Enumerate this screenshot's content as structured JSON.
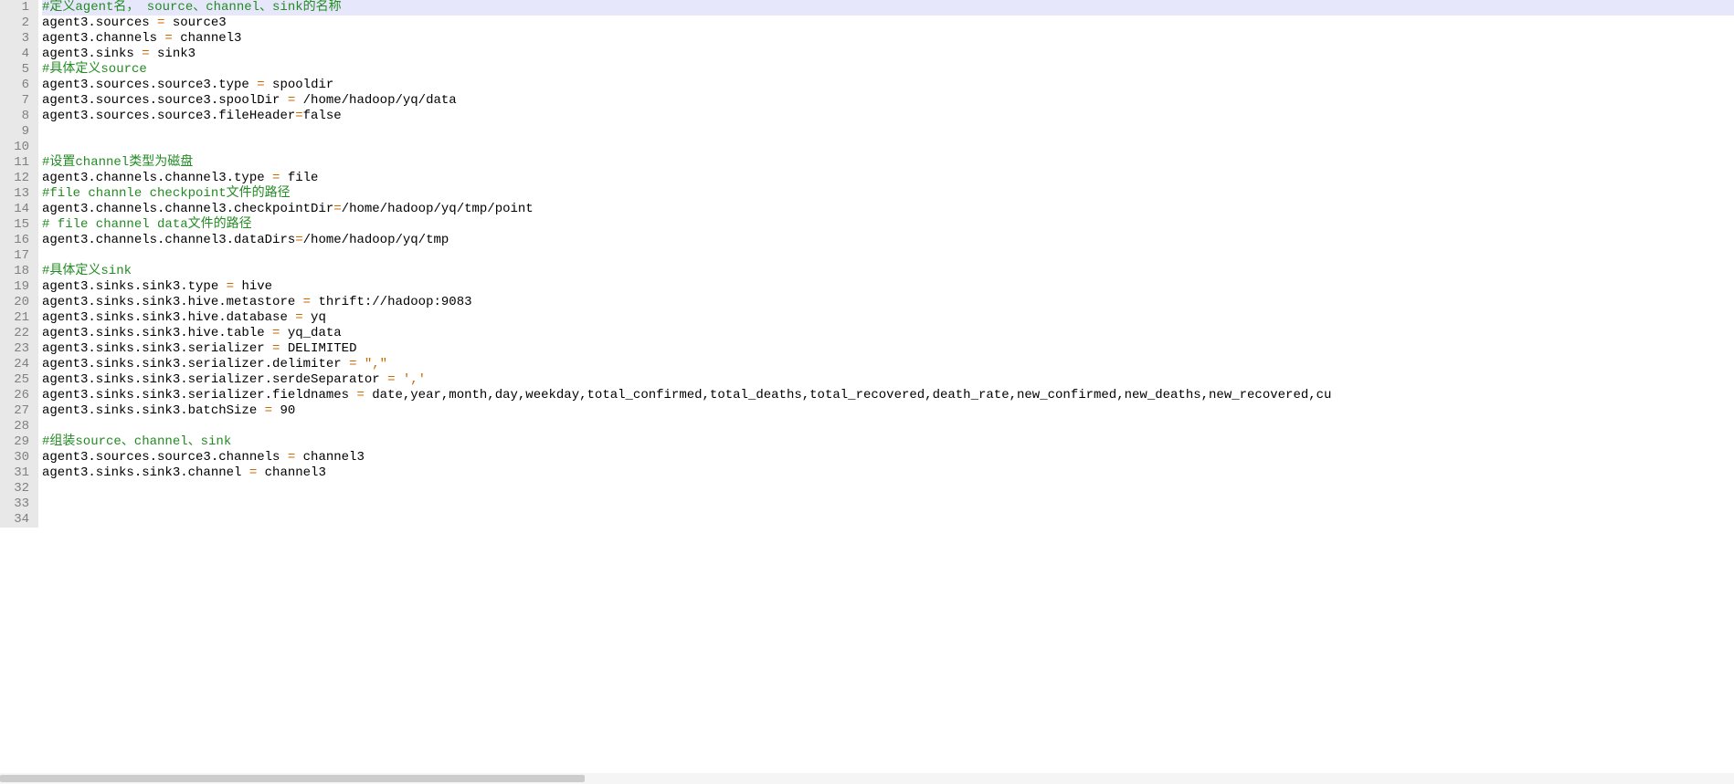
{
  "lines": [
    {
      "n": "1",
      "spans": [
        {
          "cls": "comment",
          "t": "#定义agent名， source、channel、sink的名称"
        }
      ]
    },
    {
      "n": "2",
      "spans": [
        {
          "t": "agent3.sources "
        },
        {
          "cls": "op",
          "t": "="
        },
        {
          "t": " source3"
        }
      ]
    },
    {
      "n": "3",
      "spans": [
        {
          "t": "agent3.channels "
        },
        {
          "cls": "op",
          "t": "="
        },
        {
          "t": " channel3"
        }
      ]
    },
    {
      "n": "4",
      "spans": [
        {
          "t": "agent3.sinks "
        },
        {
          "cls": "op",
          "t": "="
        },
        {
          "t": " sink3"
        }
      ]
    },
    {
      "n": "5",
      "spans": [
        {
          "cls": "comment",
          "t": "#具体定义source"
        }
      ]
    },
    {
      "n": "6",
      "spans": [
        {
          "t": "agent3.sources.source3.type "
        },
        {
          "cls": "op",
          "t": "="
        },
        {
          "t": " spooldir"
        }
      ]
    },
    {
      "n": "7",
      "spans": [
        {
          "t": "agent3.sources.source3.spoolDir "
        },
        {
          "cls": "op",
          "t": "="
        },
        {
          "t": " /home/hadoop/yq/data"
        }
      ]
    },
    {
      "n": "8",
      "spans": [
        {
          "t": "agent3.sources.source3.fileHeader"
        },
        {
          "cls": "op",
          "t": "="
        },
        {
          "t": "false"
        }
      ]
    },
    {
      "n": "9",
      "spans": [
        {
          "t": ""
        }
      ]
    },
    {
      "n": "10",
      "spans": [
        {
          "t": ""
        }
      ]
    },
    {
      "n": "11",
      "spans": [
        {
          "cls": "comment",
          "t": "#设置channel类型为磁盘"
        }
      ]
    },
    {
      "n": "12",
      "spans": [
        {
          "t": "agent3.channels.channel3.type "
        },
        {
          "cls": "op",
          "t": "="
        },
        {
          "t": " file"
        }
      ]
    },
    {
      "n": "13",
      "spans": [
        {
          "cls": "comment",
          "t": "#file channle checkpoint文件的路径"
        }
      ]
    },
    {
      "n": "14",
      "spans": [
        {
          "t": "agent3.channels.channel3.checkpointDir"
        },
        {
          "cls": "op",
          "t": "="
        },
        {
          "t": "/home/hadoop/yq/tmp/point"
        }
      ]
    },
    {
      "n": "15",
      "spans": [
        {
          "cls": "comment",
          "t": "# file channel data文件的路径"
        }
      ]
    },
    {
      "n": "16",
      "spans": [
        {
          "t": "agent3.channels.channel3.dataDirs"
        },
        {
          "cls": "op",
          "t": "="
        },
        {
          "t": "/home/hadoop/yq/tmp"
        }
      ]
    },
    {
      "n": "17",
      "spans": [
        {
          "t": ""
        }
      ]
    },
    {
      "n": "18",
      "spans": [
        {
          "cls": "comment",
          "t": "#具体定义sink"
        }
      ]
    },
    {
      "n": "19",
      "spans": [
        {
          "t": "agent3.sinks.sink3.type "
        },
        {
          "cls": "op",
          "t": "="
        },
        {
          "t": " hive"
        }
      ]
    },
    {
      "n": "20",
      "spans": [
        {
          "t": "agent3.sinks.sink3.hive.metastore "
        },
        {
          "cls": "op",
          "t": "="
        },
        {
          "t": " thrift://hadoop:9083"
        }
      ]
    },
    {
      "n": "21",
      "spans": [
        {
          "t": "agent3.sinks.sink3.hive.database "
        },
        {
          "cls": "op",
          "t": "="
        },
        {
          "t": " yq"
        }
      ]
    },
    {
      "n": "22",
      "spans": [
        {
          "t": "agent3.sinks.sink3.hive.table "
        },
        {
          "cls": "op",
          "t": "="
        },
        {
          "t": " yq_data"
        }
      ]
    },
    {
      "n": "23",
      "spans": [
        {
          "t": "agent3.sinks.sink3.serializer "
        },
        {
          "cls": "op",
          "t": "="
        },
        {
          "t": " DELIMITED"
        }
      ]
    },
    {
      "n": "24",
      "spans": [
        {
          "t": "agent3.sinks.sink3.serializer.delimiter "
        },
        {
          "cls": "op",
          "t": "="
        },
        {
          "t": " "
        },
        {
          "cls": "str",
          "t": "\",\""
        }
      ]
    },
    {
      "n": "25",
      "spans": [
        {
          "t": "agent3.sinks.sink3.serializer.serdeSeparator "
        },
        {
          "cls": "op",
          "t": "="
        },
        {
          "t": " "
        },
        {
          "cls": "str",
          "t": "','"
        }
      ]
    },
    {
      "n": "26",
      "spans": [
        {
          "t": "agent3.sinks.sink3.serializer.fieldnames "
        },
        {
          "cls": "op",
          "t": "="
        },
        {
          "t": " date,year,month,day,weekday,total_confirmed,total_deaths,total_recovered,death_rate,new_confirmed,new_deaths,new_recovered,cu"
        }
      ]
    },
    {
      "n": "27",
      "spans": [
        {
          "t": "agent3.sinks.sink3.batchSize "
        },
        {
          "cls": "op",
          "t": "="
        },
        {
          "t": " 90"
        }
      ]
    },
    {
      "n": "28",
      "spans": [
        {
          "t": ""
        }
      ]
    },
    {
      "n": "29",
      "spans": [
        {
          "cls": "comment",
          "t": "#组装source、channel、sink"
        }
      ]
    },
    {
      "n": "30",
      "spans": [
        {
          "t": "agent3.sources.source3.channels "
        },
        {
          "cls": "op",
          "t": "="
        },
        {
          "t": " channel3"
        }
      ]
    },
    {
      "n": "31",
      "spans": [
        {
          "t": "agent3.sinks.sink3.channel "
        },
        {
          "cls": "op",
          "t": "="
        },
        {
          "t": " channel3"
        }
      ]
    },
    {
      "n": "32",
      "spans": [
        {
          "t": ""
        }
      ]
    },
    {
      "n": "33",
      "spans": [
        {
          "t": ""
        }
      ]
    },
    {
      "n": "34",
      "spans": [
        {
          "t": ""
        }
      ]
    }
  ]
}
